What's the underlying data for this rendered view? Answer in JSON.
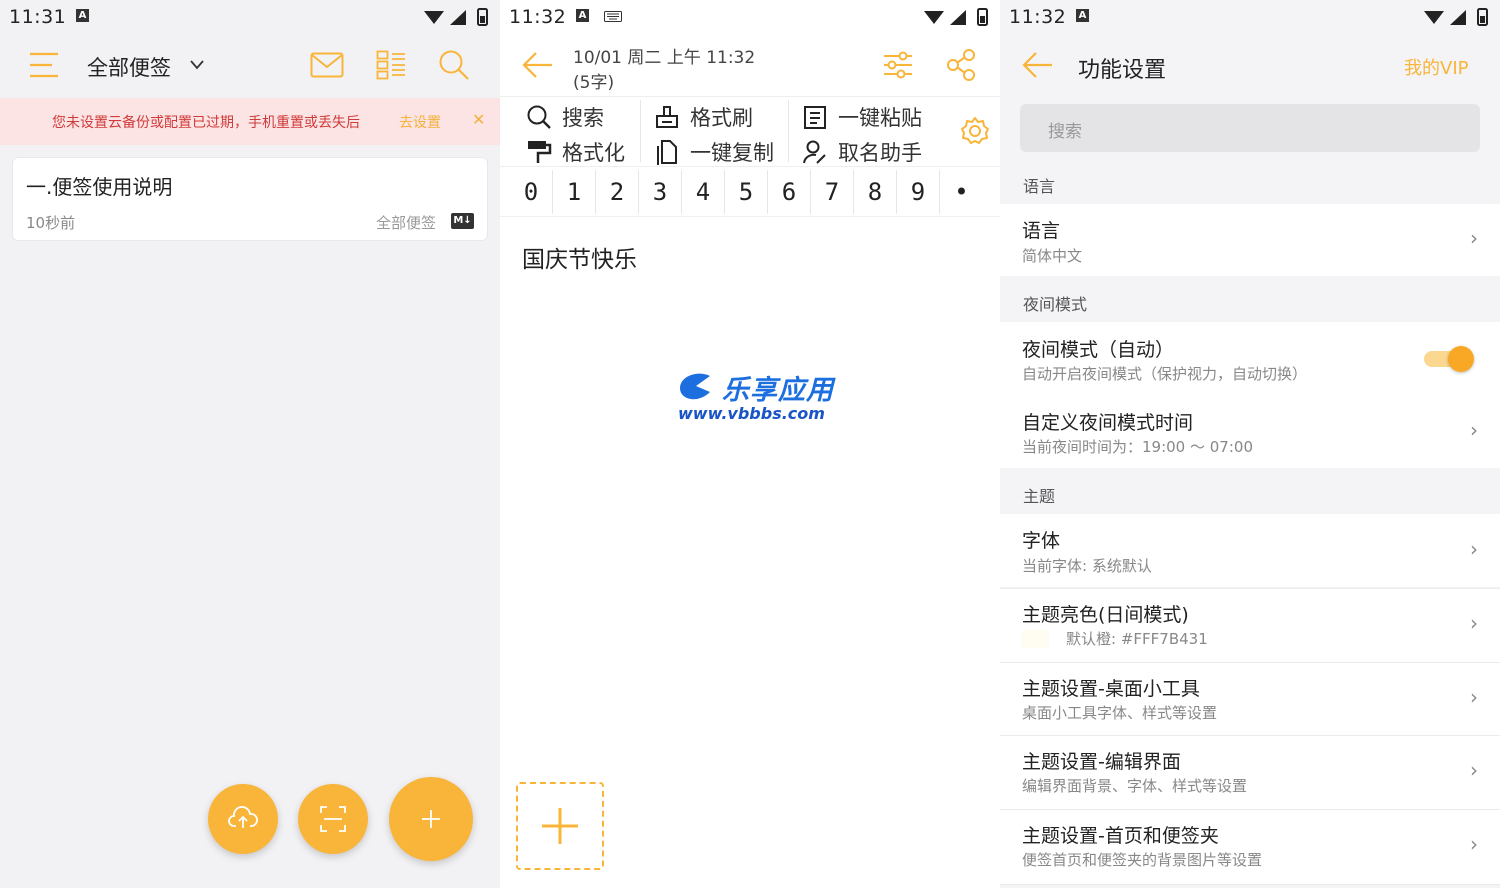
{
  "colors": {
    "accent": "#F9B43A",
    "banner_bg": "#FDE4E4",
    "banner_text": "#D03A3A",
    "theme_color": "#FFF7B431"
  },
  "panel1": {
    "time": "11:31",
    "title": "全部便签",
    "banner": {
      "text": "您未设置云备份或配置已过期，手机重置或丢失后",
      "link": "去设置",
      "close": "✕"
    },
    "note": {
      "title": "一.便签使用说明",
      "time": "10秒前",
      "folder": "全部便签",
      "badge": "M↓"
    }
  },
  "panel2": {
    "time": "11:32",
    "date": "10/01 周二 上午 11:32",
    "count": "(5字)",
    "tools": {
      "search": "搜索",
      "format_brush": "格式刷",
      "paste": "一键粘贴",
      "format": "格式化",
      "copy": "一键复制",
      "naming": "取名助手"
    },
    "digits": [
      "0",
      "1",
      "2",
      "3",
      "4",
      "5",
      "6",
      "7",
      "8",
      "9",
      "•"
    ],
    "body": "国庆节快乐",
    "watermark": {
      "name": "乐享应用",
      "url": "www.vbbbs.com"
    }
  },
  "panel3": {
    "time": "11:32",
    "title": "功能设置",
    "vip": "我的VIP",
    "search_placeholder": "搜索",
    "sections": {
      "language": "语言",
      "night": "夜间模式",
      "theme": "主题"
    },
    "rows": {
      "language": {
        "title": "语言",
        "sub": "简体中文"
      },
      "night_auto": {
        "title": "夜间模式（自动）",
        "sub": "自动开启夜间模式（保护视力，自动切换）"
      },
      "night_time": {
        "title": "自定义夜间模式时间",
        "sub": "当前夜间时间为：19:00 ～ 07:00"
      },
      "font": {
        "title": "字体",
        "sub": "当前字体: 系统默认"
      },
      "theme_color": {
        "title": "主题亮色(日间模式)",
        "sub": "默认橙: #FFF7B431"
      },
      "widget": {
        "title": "主题设置-桌面小工具",
        "sub": "桌面小工具字体、样式等设置"
      },
      "editor": {
        "title": "主题设置-编辑界面",
        "sub": "编辑界面背景、字体、样式等设置"
      },
      "home": {
        "title": "主题设置-首页和便签夹",
        "sub": "便签首页和便签夹的背景图片等设置"
      }
    },
    "chevron": "›"
  }
}
